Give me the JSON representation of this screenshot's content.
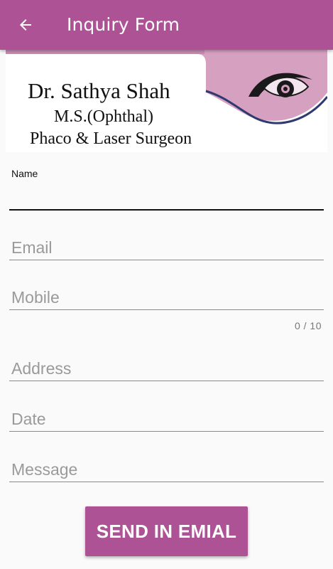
{
  "colors": {
    "primary": "#ad5395",
    "on_primary": "#ffffff",
    "background": "#fafafa"
  },
  "appbar": {
    "back_icon": "arrow-left-icon",
    "title": "Inquiry Form"
  },
  "banner": {
    "doctor_name": "Dr. Sathya Shah",
    "qualification": "M.S.(Ophthal)",
    "specialty": "Phaco & Laser Surgeon",
    "logo_icon": "eye-icon"
  },
  "form": {
    "name": {
      "label": "Name",
      "value": ""
    },
    "email": {
      "placeholder": "Email",
      "value": ""
    },
    "mobile": {
      "placeholder": "Mobile",
      "value": "",
      "counter": "0 / 10"
    },
    "address": {
      "placeholder": "Address",
      "value": ""
    },
    "date": {
      "placeholder": "Date",
      "value": ""
    },
    "message": {
      "placeholder": "Message",
      "value": ""
    }
  },
  "send_button": {
    "label": "SEND IN EMIAL"
  }
}
